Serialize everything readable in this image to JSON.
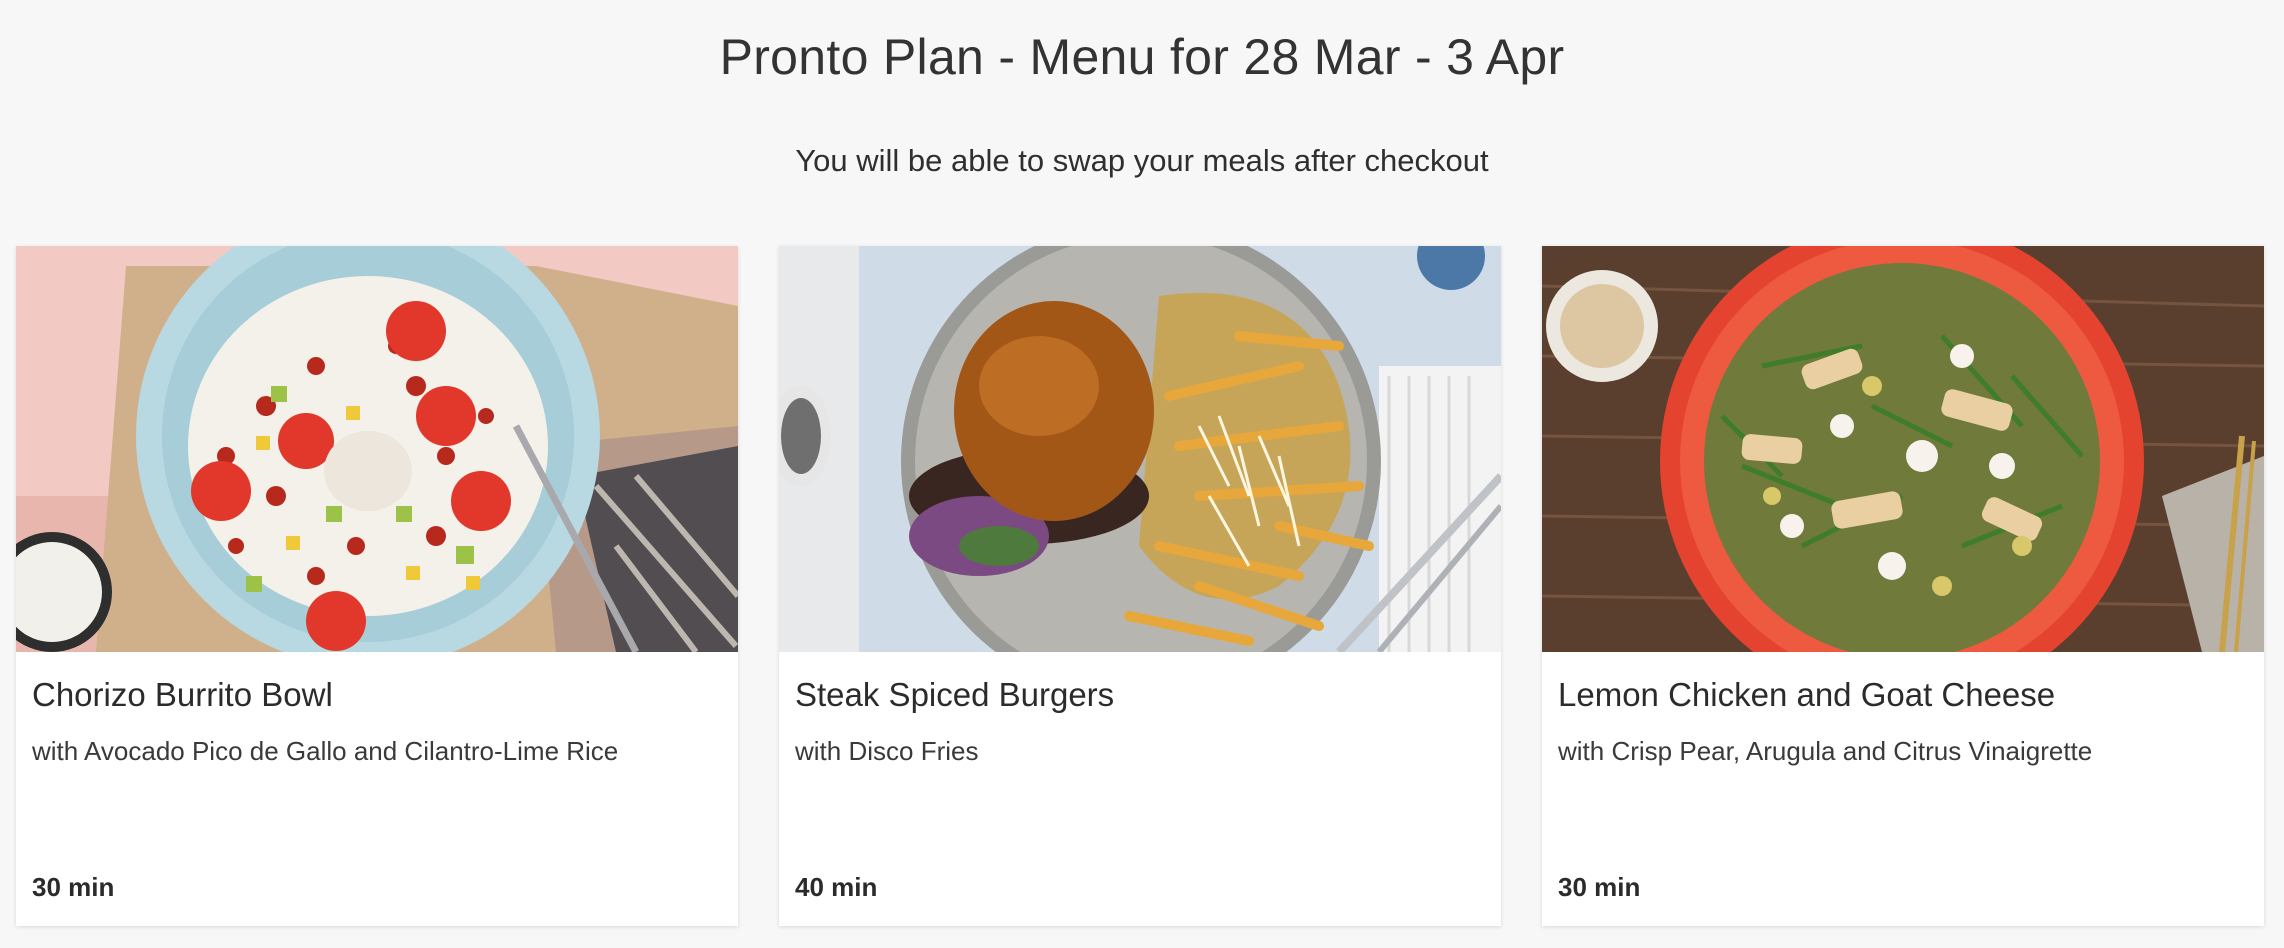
{
  "header": {
    "title": "Pronto Plan - Menu for 28 Mar - 3 Apr",
    "subtitle": "You will be able to swap your meals after checkout"
  },
  "recipes": [
    {
      "title": "Chorizo Burrito Bowl",
      "subtitle": "with Avocado Pico de Gallo and Cilantro-Lime Rice",
      "time": "30 min",
      "image": "chorizo-burrito-bowl-photo"
    },
    {
      "title": "Steak Spiced Burgers",
      "subtitle": "with Disco Fries",
      "time": "40 min",
      "image": "steak-spiced-burgers-photo"
    },
    {
      "title": "Lemon Chicken and Goat Cheese",
      "subtitle": "with Crisp Pear, Arugula and Citrus Vinaigrette",
      "time": "30 min",
      "image": "lemon-chicken-goat-cheese-photo"
    }
  ],
  "colors": {
    "page_background": "#f7f7f7",
    "card_background": "#ffffff",
    "text": "#2b2b2b"
  }
}
